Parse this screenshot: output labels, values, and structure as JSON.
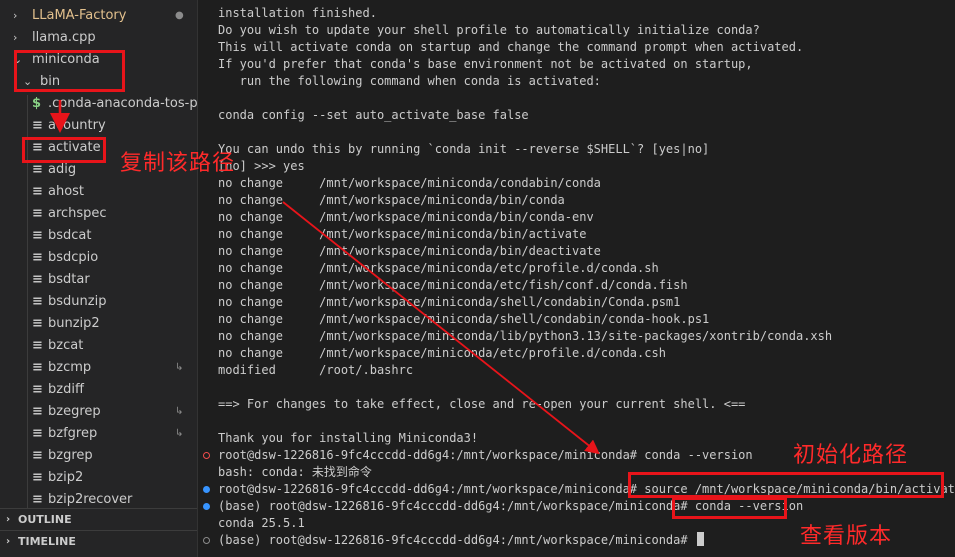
{
  "sidebar": {
    "items": [
      {
        "label": "LLaMA-Factory",
        "chevron": "›",
        "badge": "●",
        "color": "#e2c08d",
        "depth": 0
      },
      {
        "label": "llama.cpp",
        "chevron": "›",
        "depth": 0
      },
      {
        "label": "miniconda",
        "chevron": "⌄",
        "depth": 0
      },
      {
        "label": "bin",
        "chevron": "⌄",
        "depth": 1
      },
      {
        "label": ".conda-anaconda-tos-pr...",
        "icon": "$",
        "icon_color": "#89d185",
        "depth": 2
      },
      {
        "label": "acountry",
        "icon": "≡",
        "depth": 2
      },
      {
        "label": "activate",
        "icon": "≡",
        "depth": 2
      },
      {
        "label": "adig",
        "icon": "≡",
        "depth": 2
      },
      {
        "label": "ahost",
        "icon": "≡",
        "depth": 2
      },
      {
        "label": "archspec",
        "icon": "≡",
        "depth": 2
      },
      {
        "label": "bsdcat",
        "icon": "≡",
        "depth": 2
      },
      {
        "label": "bsdcpio",
        "icon": "≡",
        "depth": 2
      },
      {
        "label": "bsdtar",
        "icon": "≡",
        "depth": 2
      },
      {
        "label": "bsdunzip",
        "icon": "≡",
        "depth": 2
      },
      {
        "label": "bunzip2",
        "icon": "≡",
        "depth": 2
      },
      {
        "label": "bzcat",
        "icon": "≡",
        "depth": 2
      },
      {
        "label": "bzcmp",
        "icon": "≡",
        "badge": "↳",
        "depth": 2
      },
      {
        "label": "bzdiff",
        "icon": "≡",
        "depth": 2
      },
      {
        "label": "bzegrep",
        "icon": "≡",
        "badge": "↳",
        "depth": 2
      },
      {
        "label": "bzfgrep",
        "icon": "≡",
        "badge": "↳",
        "depth": 2
      },
      {
        "label": "bzgrep",
        "icon": "≡",
        "depth": 2
      },
      {
        "label": "bzip2",
        "icon": "≡",
        "depth": 2
      },
      {
        "label": "bzip2recover",
        "icon": "≡",
        "depth": 2
      }
    ],
    "sections": [
      {
        "label": "OUTLINE",
        "chevron": "›"
      },
      {
        "label": "TIMELINE",
        "chevron": "›"
      }
    ]
  },
  "terminal": {
    "lines": [
      {
        "text": "installation finished."
      },
      {
        "text": "Do you wish to update your shell profile to automatically initialize conda?"
      },
      {
        "text": "This will activate conda on startup and change the command prompt when activated."
      },
      {
        "text": "If you'd prefer that conda's base environment not be activated on startup,"
      },
      {
        "text": "   run the following command when conda is activated:"
      },
      {
        "text": ""
      },
      {
        "text": "conda config --set auto_activate_base false"
      },
      {
        "text": ""
      },
      {
        "text": "You can undo this by running `conda init --reverse $SHELL`? [yes|no]"
      },
      {
        "text": "[no] >>> yes"
      },
      {
        "text": "no change     /mnt/workspace/miniconda/condabin/conda"
      },
      {
        "text": "no change     /mnt/workspace/miniconda/bin/conda"
      },
      {
        "text": "no change     /mnt/workspace/miniconda/bin/conda-env"
      },
      {
        "text": "no change     /mnt/workspace/miniconda/bin/activate"
      },
      {
        "text": "no change     /mnt/workspace/miniconda/bin/deactivate"
      },
      {
        "text": "no change     /mnt/workspace/miniconda/etc/profile.d/conda.sh"
      },
      {
        "text": "no change     /mnt/workspace/miniconda/etc/fish/conf.d/conda.fish"
      },
      {
        "text": "no change     /mnt/workspace/miniconda/shell/condabin/Conda.psm1"
      },
      {
        "text": "no change     /mnt/workspace/miniconda/shell/condabin/conda-hook.ps1"
      },
      {
        "text": "no change     /mnt/workspace/miniconda/lib/python3.13/site-packages/xontrib/conda.xsh"
      },
      {
        "text": "no change     /mnt/workspace/miniconda/etc/profile.d/conda.csh"
      },
      {
        "text": "modified      /root/.bashrc"
      },
      {
        "text": ""
      },
      {
        "text": "==> For changes to take effect, close and re-open your current shell. <=="
      },
      {
        "text": ""
      },
      {
        "text": "Thank you for installing Miniconda3!"
      },
      {
        "text": "root@dsw-1226816-9fc4cccdd-dd6g4:/mnt/workspace/miniconda# conda --version",
        "dot": "err"
      },
      {
        "text": "bash: conda: 未找到命令"
      },
      {
        "text": "root@dsw-1226816-9fc4cccdd-dd6g4:/mnt/workspace/miniconda# source /mnt/workspace/miniconda/bin/activate",
        "dot": "ok"
      },
      {
        "text": "(base) root@dsw-1226816-9fc4cccdd-dd6g4:/mnt/workspace/miniconda# conda --version",
        "dot": "ok"
      },
      {
        "text": "conda 25.5.1"
      },
      {
        "text": "(base) root@dsw-1226816-9fc4cccdd-dd6g4:/mnt/workspace/miniconda# ",
        "dot": "idle",
        "cursor": true
      }
    ]
  },
  "annotations": {
    "copy_path": "复制该路径",
    "init_path": "初始化路径",
    "check_version": "查看版本"
  },
  "colors": {
    "annotation_red": "#e8141a",
    "sidebar_bg": "#252526",
    "terminal_bg": "#1e1e1e",
    "text": "#cccccc"
  }
}
